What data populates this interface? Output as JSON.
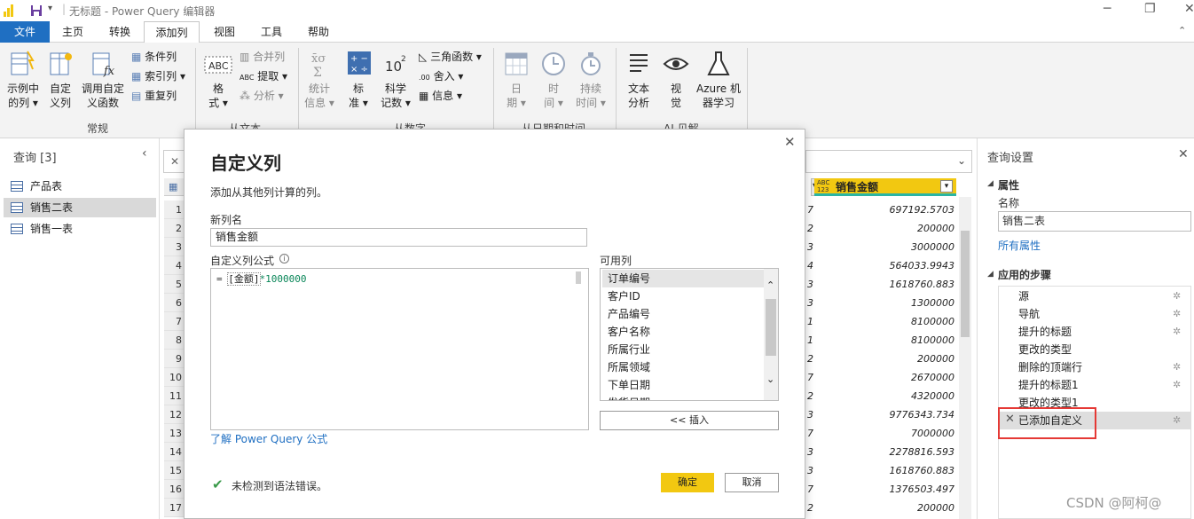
{
  "titlebar": {
    "title": "无标题 - Power Query 编辑器"
  },
  "menu": {
    "tabs": [
      "文件",
      "主页",
      "转换",
      "添加列",
      "视图",
      "工具",
      "帮助"
    ]
  },
  "ribbon": {
    "example_col": [
      "示例中",
      "的列 ▾"
    ],
    "custom_col": [
      "自定",
      "义列"
    ],
    "invoke_fn": [
      "调用自定",
      "义函数"
    ],
    "cond_col": "条件列",
    "index_col": "索引列 ▾",
    "dup_col": "重复列",
    "group_general": "常规",
    "format": [
      "格",
      "式 ▾"
    ],
    "merge_cols": "合并列",
    "extract": "提取 ▾",
    "parse": "分析 ▾",
    "group_text": "从文本",
    "stats": [
      "统计",
      "信息 ▾"
    ],
    "standard": [
      "标",
      "准 ▾"
    ],
    "scientific": [
      "科学",
      "记数 ▾"
    ],
    "trig": "三角函数 ▾",
    "rounding": "舍入 ▾",
    "info": "信息 ▾",
    "group_number": "从数字",
    "date": [
      "日",
      "期 ▾"
    ],
    "time": [
      "时",
      "间 ▾"
    ],
    "duration": [
      "持续",
      "时间 ▾"
    ],
    "group_datetime": "从日期和时间",
    "text_analytics": [
      "文本",
      "分析"
    ],
    "vision": [
      "视",
      "觉"
    ],
    "azure_ml": [
      "Azure 机",
      "器学习"
    ],
    "group_ai": "AI 见解"
  },
  "queries": {
    "header": "查询 [3]",
    "items": [
      "产品表",
      "销售二表",
      "销售一表"
    ]
  },
  "grid": {
    "column_header": "销售金额",
    "column_type": "ABC\n123",
    "row_numbers": [
      "1",
      "2",
      "3",
      "4",
      "5",
      "6",
      "7",
      "8",
      "9",
      "10",
      "11",
      "12",
      "13",
      "14",
      "15",
      "16",
      "17"
    ],
    "left_fragments": [
      "7",
      "2",
      "3",
      "4",
      "3",
      "3",
      "1",
      "1",
      "2",
      "7",
      "2",
      "3",
      "7",
      "3",
      "3",
      "7",
      "2"
    ],
    "values": [
      "697192.5703",
      "200000",
      "3000000",
      "564033.9943",
      "1618760.883",
      "1300000",
      "8100000",
      "8100000",
      "200000",
      "2670000",
      "4320000",
      "9776343.734",
      "7000000",
      "2278816.593",
      "1618760.883",
      "1376503.497",
      "200000"
    ]
  },
  "settings": {
    "title": "查询设置",
    "props_header": "属性",
    "name_label": "名称",
    "name_value": "销售二表",
    "all_props": "所有属性",
    "steps_header": "应用的步骤",
    "steps": [
      "源",
      "导航",
      "提升的标题",
      "更改的类型",
      "删除的顶端行",
      "提升的标题1",
      "更改的类型1",
      "已添加自定义"
    ]
  },
  "dialog": {
    "title": "自定义列",
    "subtitle": "添加从其他列计算的列。",
    "new_col_label": "新列名",
    "new_col_value": "销售金额",
    "formula_label": "自定义列公式",
    "formula_prefix": "= ",
    "formula_field": "[金额]",
    "formula_suffix": "*1000000",
    "available_label": "可用列",
    "available_cols": [
      "订单编号",
      "客户ID",
      "产品编号",
      "客户名称",
      "所属行业",
      "所属领域",
      "下单日期",
      "发货日期"
    ],
    "insert_button": "<< 插入",
    "learn_link": "了解 Power Query 公式",
    "status": "未检测到语法错误。",
    "ok_button": "确定",
    "cancel_button": "取消"
  },
  "watermark": "CSDN @阿柯@",
  "colors": {
    "accent": "#1f6fc2",
    "ok_button": "#f2c811",
    "highlight_box": "#e53935",
    "column_header": "#f2c811"
  }
}
